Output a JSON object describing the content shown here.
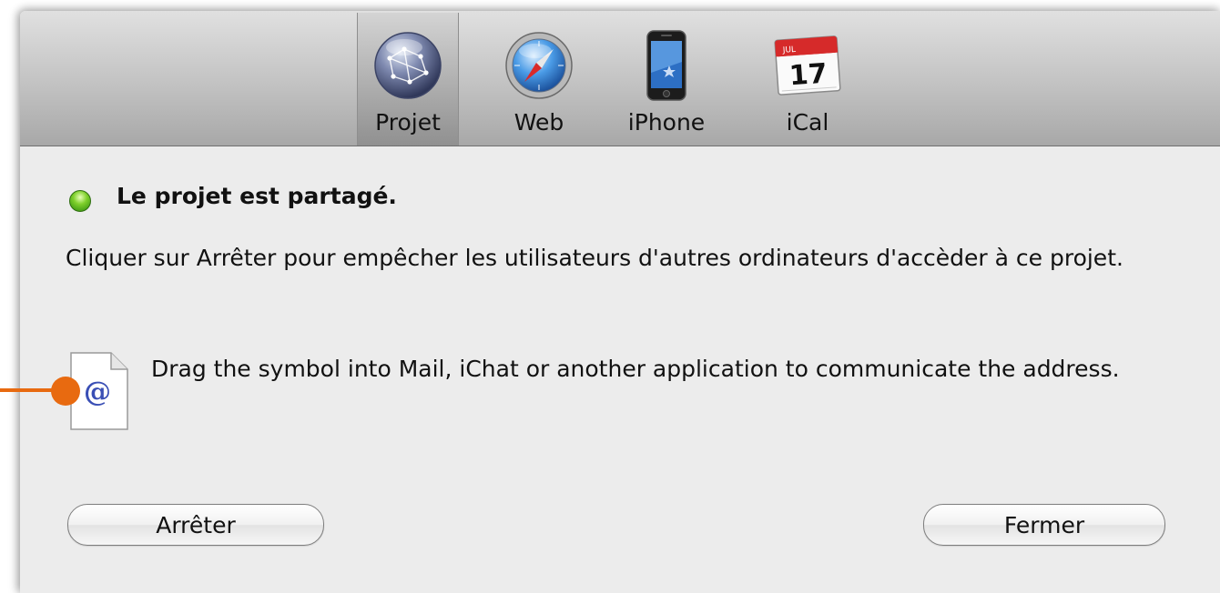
{
  "toolbar": {
    "items": [
      {
        "label": "Projet",
        "icon": "network-globe-icon"
      },
      {
        "label": "Web",
        "icon": "safari-compass-icon"
      },
      {
        "label": "iPhone",
        "icon": "iphone-icon"
      },
      {
        "label": "iCal",
        "icon": "calendar-icon",
        "icon_text": "17",
        "icon_month": "JUL"
      }
    ],
    "selected": "Projet"
  },
  "status": {
    "text": "Le projet est partagé.",
    "color": "#6cc227"
  },
  "description": "Cliquer sur Arrêter pour empêcher les utilisateurs d'autres ordinateurs d'accèder à ce projet.",
  "drag": {
    "icon": "address-document-icon",
    "icon_symbol": "@",
    "text": "Drag the symbol into Mail, iChat or another application to communicate the address."
  },
  "buttons": {
    "stop": "Arrêter",
    "close": "Fermer"
  },
  "annotation": {
    "color": "#e86a10"
  }
}
